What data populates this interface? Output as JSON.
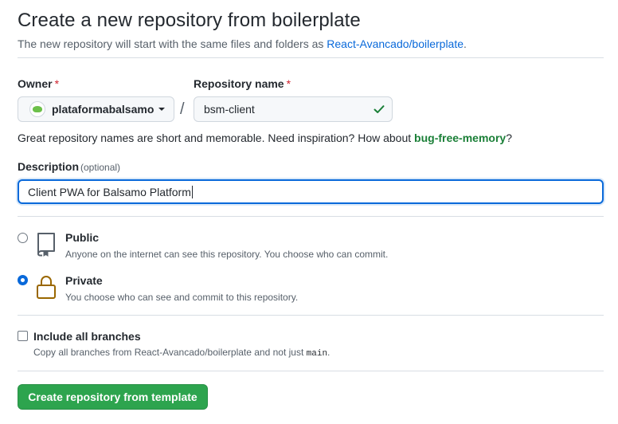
{
  "header": {
    "title": "Create a new repository from boilerplate",
    "subtitle_prefix": "The new repository will start with the same files and folders as ",
    "template_link": "React-Avancado/boilerplate",
    "subtitle_suffix": "."
  },
  "owner": {
    "label": "Owner",
    "required_mark": "*",
    "value": "plataformabalsamo"
  },
  "repo_name": {
    "label": "Repository name",
    "required_mark": "*",
    "value": "bsm-client",
    "separator": "/"
  },
  "hint": {
    "text": "Great repository names are short and memorable. Need inspiration? How about ",
    "suggestion": "bug-free-memory",
    "suffix": "?"
  },
  "description": {
    "label": "Description",
    "optional": "(optional)",
    "value": "Client PWA for Balsamo Platform"
  },
  "visibility": {
    "options": [
      {
        "title": "Public",
        "description": "Anyone on the internet can see this repository. You choose who can commit.",
        "icon": "repo-book-icon",
        "checked": false
      },
      {
        "title": "Private",
        "description": "You choose who can see and commit to this repository.",
        "icon": "lock-icon",
        "checked": true
      }
    ]
  },
  "branches": {
    "label": "Include all branches",
    "description_prefix": "Copy all branches from React-Avancado/boilerplate and not just ",
    "code": "main",
    "description_suffix": ".",
    "checked": false
  },
  "submit": {
    "label": "Create repository from template"
  },
  "colors": {
    "accent": "#0969da",
    "success": "#2da44e",
    "suggestion": "#1a7f37",
    "required": "#cf222e",
    "lock": "#9a6700"
  }
}
